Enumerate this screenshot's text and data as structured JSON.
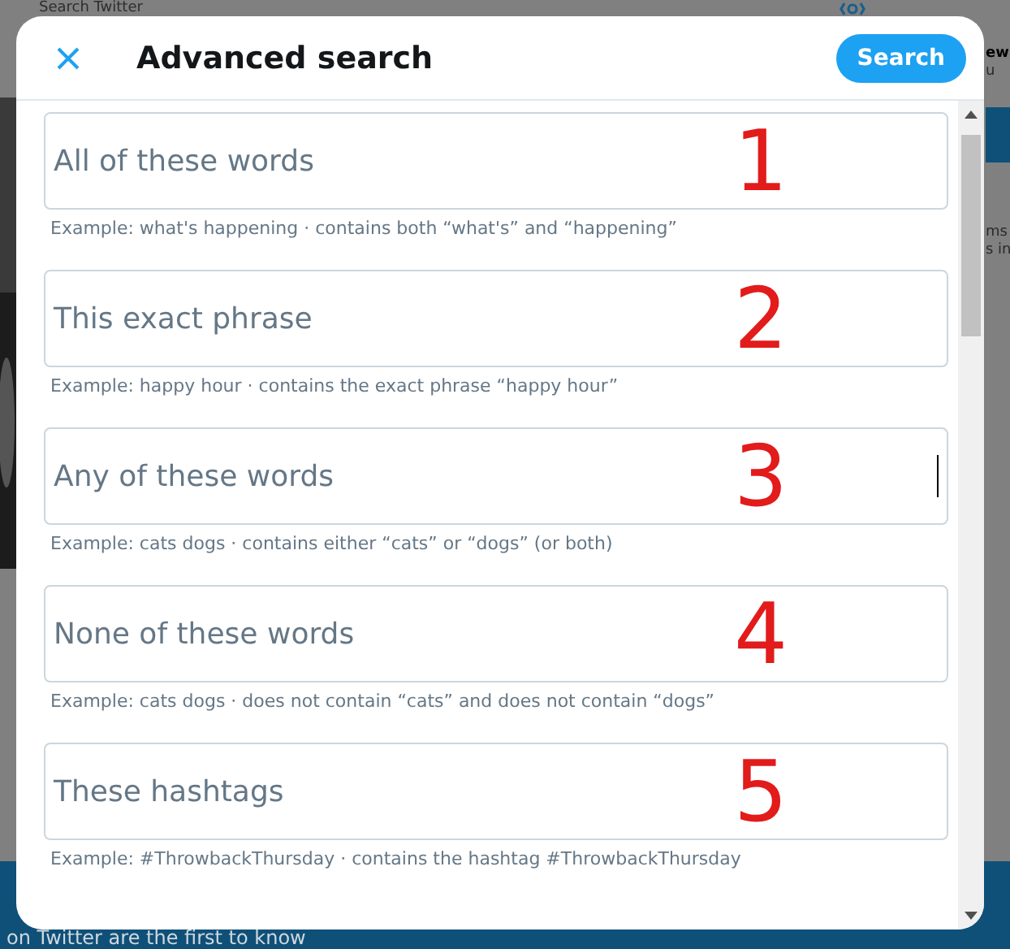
{
  "backdrop": {
    "search_placeholder": "Search Twitter",
    "right_fragments": [
      "ew",
      "u",
      "ms",
      "s in"
    ],
    "banner_text": "on Twitter are the first to know"
  },
  "dialog": {
    "title": "Advanced search",
    "search_button": "Search",
    "fields": [
      {
        "placeholder": "All of these words",
        "hint": "Example: what's happening · contains both “what's” and “happening”",
        "annotation": "1",
        "focused": false
      },
      {
        "placeholder": "This exact phrase",
        "hint": "Example: happy hour · contains the exact phrase “happy hour”",
        "annotation": "2",
        "focused": false
      },
      {
        "placeholder": "Any of these words",
        "hint": "Example: cats dogs · contains either “cats” or “dogs” (or both)",
        "annotation": "3",
        "focused": true
      },
      {
        "placeholder": "None of these words",
        "hint": "Example: cats dogs · does not contain “cats” and does not contain “dogs”",
        "annotation": "4",
        "focused": false
      },
      {
        "placeholder": "These hashtags",
        "hint": "Example: #ThrowbackThursday · contains the hashtag #ThrowbackThursday",
        "annotation": "5",
        "focused": false
      }
    ]
  }
}
